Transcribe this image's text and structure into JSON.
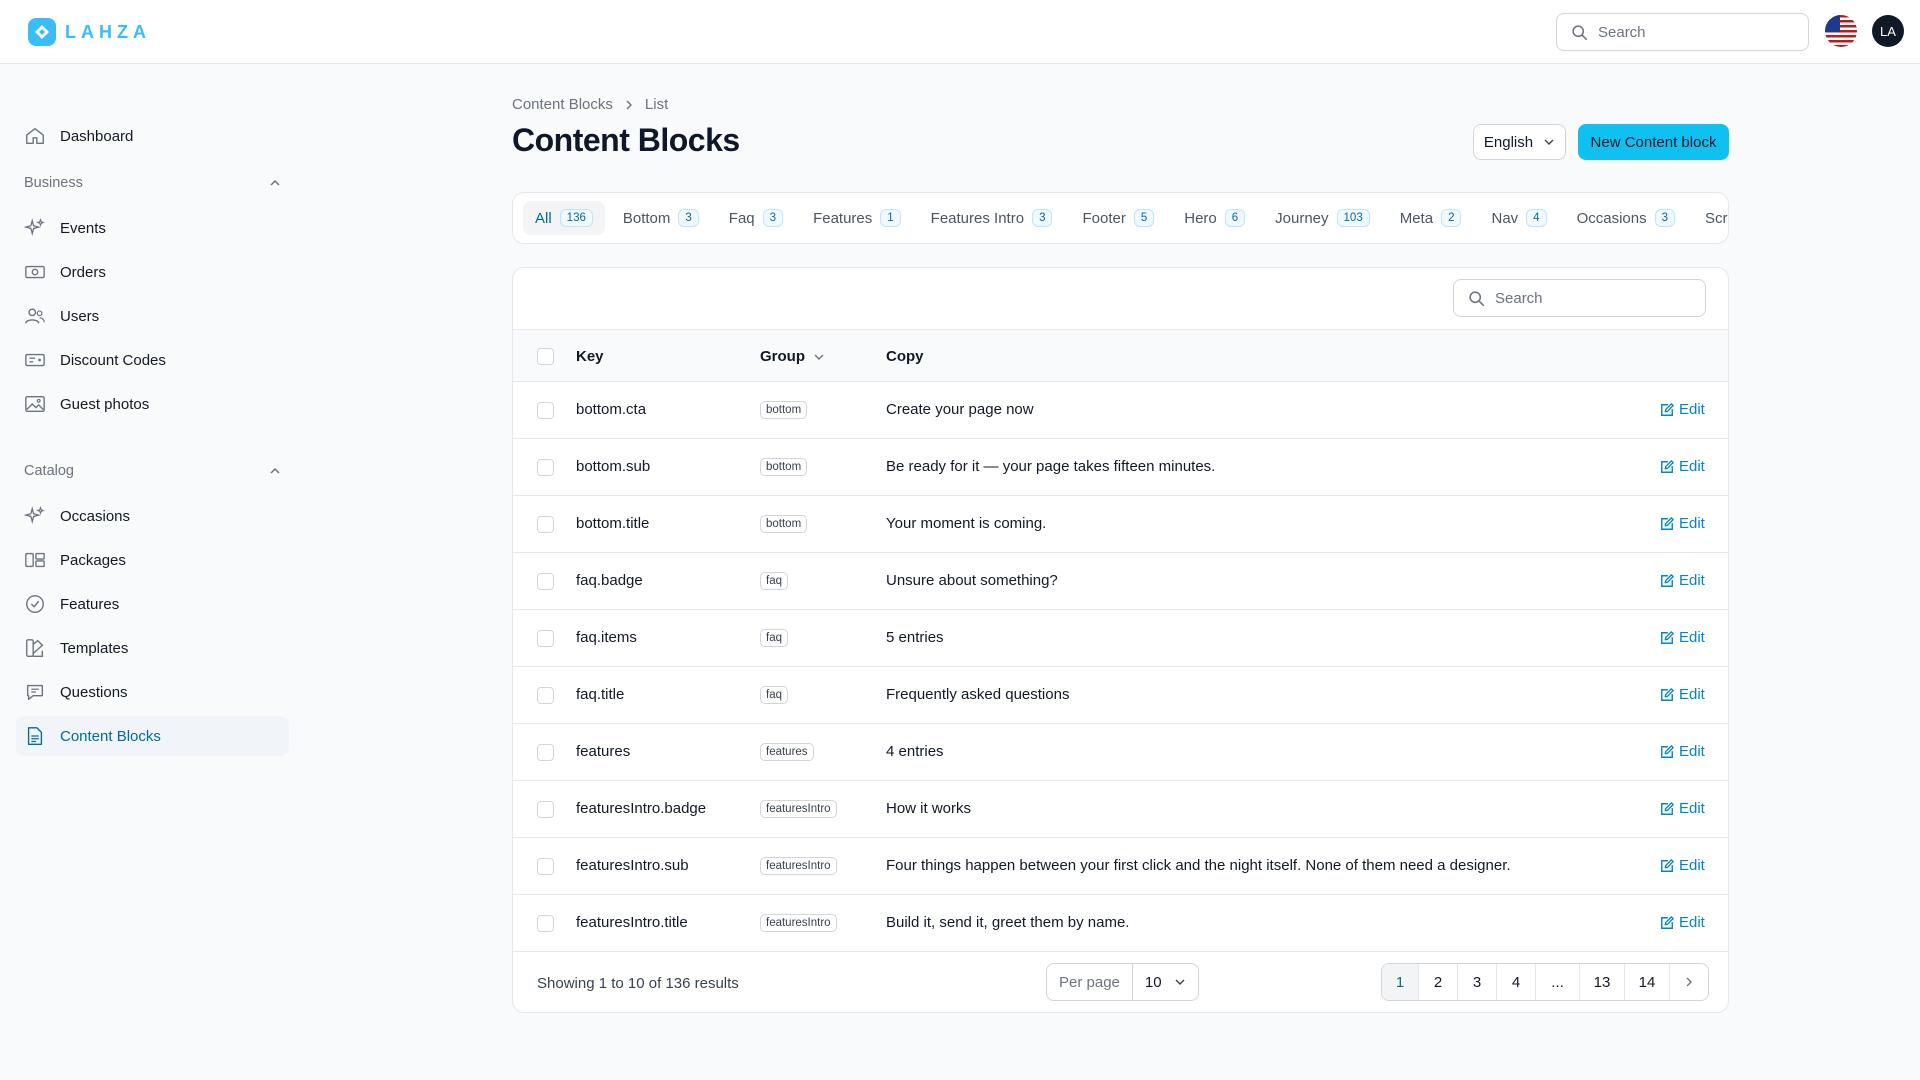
{
  "brand": {
    "name": "LAHZA"
  },
  "header": {
    "search_placeholder": "Search",
    "avatar_initials": "LA"
  },
  "sidebar": {
    "dashboard": "Dashboard",
    "groups": [
      {
        "label": "Business",
        "items": [
          {
            "label": "Events",
            "icon": "sparkles-icon"
          },
          {
            "label": "Orders",
            "icon": "banknotes-icon"
          },
          {
            "label": "Users",
            "icon": "users-icon"
          },
          {
            "label": "Discount Codes",
            "icon": "ticket-icon"
          },
          {
            "label": "Guest photos",
            "icon": "photo-icon"
          }
        ]
      },
      {
        "label": "Catalog",
        "items": [
          {
            "label": "Occasions",
            "icon": "sparkles-icon"
          },
          {
            "label": "Packages",
            "icon": "squares-icon"
          },
          {
            "label": "Features",
            "icon": "check-badge-icon"
          },
          {
            "label": "Templates",
            "icon": "swatch-icon"
          },
          {
            "label": "Questions",
            "icon": "chat-icon"
          },
          {
            "label": "Content Blocks",
            "icon": "document-icon",
            "active": true
          }
        ]
      }
    ]
  },
  "breadcrumb": {
    "parent": "Content Blocks",
    "current": "List"
  },
  "page": {
    "title": "Content Blocks",
    "language": "English",
    "new_button": "New Content block"
  },
  "tabs": [
    {
      "label": "All",
      "count": "136",
      "active": true
    },
    {
      "label": "Bottom",
      "count": "3"
    },
    {
      "label": "Faq",
      "count": "3"
    },
    {
      "label": "Features",
      "count": "1"
    },
    {
      "label": "Features Intro",
      "count": "3"
    },
    {
      "label": "Footer",
      "count": "5"
    },
    {
      "label": "Hero",
      "count": "6"
    },
    {
      "label": "Journey",
      "count": "103"
    },
    {
      "label": "Meta",
      "count": "2"
    },
    {
      "label": "Nav",
      "count": "4"
    },
    {
      "label": "Occasions",
      "count": "3"
    },
    {
      "label": "Scroll Cu",
      "count": ""
    }
  ],
  "table": {
    "search_placeholder": "Search",
    "columns": {
      "key": "Key",
      "group": "Group",
      "copy": "Copy"
    },
    "edit_label": "Edit",
    "rows": [
      {
        "key": "bottom.cta",
        "group": "bottom",
        "copy": "Create your page now"
      },
      {
        "key": "bottom.sub",
        "group": "bottom",
        "copy": "Be ready for it — your page takes fifteen minutes."
      },
      {
        "key": "bottom.title",
        "group": "bottom",
        "copy": "Your moment is coming."
      },
      {
        "key": "faq.badge",
        "group": "faq",
        "copy": "Unsure about something?"
      },
      {
        "key": "faq.items",
        "group": "faq",
        "copy": "5 entries"
      },
      {
        "key": "faq.title",
        "group": "faq",
        "copy": "Frequently asked questions"
      },
      {
        "key": "features",
        "group": "features",
        "copy": "4 entries"
      },
      {
        "key": "featuresIntro.badge",
        "group": "featuresIntro",
        "copy": "How it works"
      },
      {
        "key": "featuresIntro.sub",
        "group": "featuresIntro",
        "copy": "Four things happen between your first click and the night itself. None of them need a designer."
      },
      {
        "key": "featuresIntro.title",
        "group": "featuresIntro",
        "copy": "Build it, send it, greet them by name."
      }
    ],
    "footer": {
      "summary": "Showing 1 to 10 of 136 results",
      "per_page_label": "Per page",
      "per_page_value": "10",
      "pages": [
        "1",
        "2",
        "3",
        "4",
        "...",
        "13",
        "14"
      ]
    }
  },
  "colors": {
    "accent": "#0ec1f0",
    "link": "#0284c7"
  }
}
